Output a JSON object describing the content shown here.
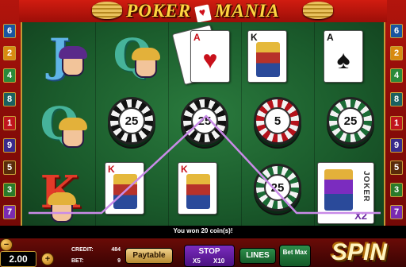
{
  "title": {
    "left": "POKER",
    "right": "MANIA",
    "card_suit": "♥"
  },
  "lines_left": [
    {
      "num": "6",
      "color": "#1a55a0"
    },
    {
      "num": "2",
      "color": "#d88a10"
    },
    {
      "num": "4",
      "color": "#2a8a3a"
    },
    {
      "num": "8",
      "color": "#1a6060"
    },
    {
      "num": "1",
      "color": "#c0141c"
    },
    {
      "num": "9",
      "color": "#3a2a8a"
    },
    {
      "num": "5",
      "color": "#5a2a0a"
    },
    {
      "num": "3",
      "color": "#2a7a2a"
    },
    {
      "num": "7",
      "color": "#7a2ab0"
    }
  ],
  "lines_right": [
    {
      "num": "6",
      "color": "#1a55a0"
    },
    {
      "num": "2",
      "color": "#d88a10"
    },
    {
      "num": "4",
      "color": "#2a8a3a"
    },
    {
      "num": "8",
      "color": "#1a6060"
    },
    {
      "num": "1",
      "color": "#c0141c"
    },
    {
      "num": "9",
      "color": "#3a2a8a"
    },
    {
      "num": "5",
      "color": "#5a2a0a"
    },
    {
      "num": "3",
      "color": "#2a7a2a"
    },
    {
      "num": "7",
      "color": "#7a2ab0"
    }
  ],
  "reels": {
    "r1c1": "J",
    "r2c1": "Q",
    "r3c1": "K",
    "r1c2": "Q",
    "chip_r2c2": "25",
    "chip_r2c3": "25",
    "chip_r2c4": "5",
    "chip_r2c5": "25",
    "chip_r3c4": "25",
    "card_k": "K",
    "card_a": "A",
    "joker": "JOKER",
    "x2": "X2"
  },
  "win_message": "You won 20 coin(s)!",
  "win_line_color": "#c98be8",
  "bottom": {
    "bet_value": "2.00",
    "minus": "−",
    "plus": "+",
    "credit_label": "CREDIT:",
    "credit_value": "484",
    "bet_label": "BET:",
    "bet_value_small": "9",
    "paytable": "Paytable",
    "stop": "STOP",
    "stop_x5": "X5",
    "stop_x10": "X10",
    "lines": "LINES",
    "bet_max": "Bet Max",
    "spin": "SPIN"
  }
}
